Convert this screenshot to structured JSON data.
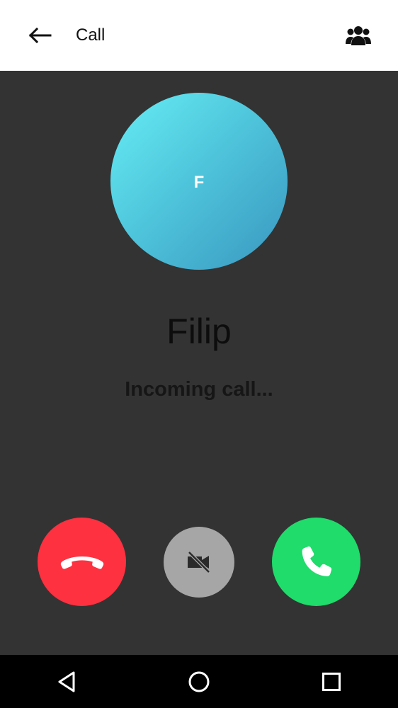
{
  "app_bar": {
    "title": "Call",
    "back_icon": "arrow-left-icon",
    "group_icon": "people-group-icon"
  },
  "caller": {
    "initial": "F",
    "name": "Filip",
    "status": "Incoming call..."
  },
  "actions": {
    "decline_icon": "phone-hangup-icon",
    "video_icon": "video-off-icon",
    "accept_icon": "phone-icon"
  },
  "nav_bar": {
    "back_icon": "nav-back-triangle-icon",
    "home_icon": "nav-home-circle-icon",
    "recents_icon": "nav-recents-square-icon"
  },
  "colors": {
    "background": "#333333",
    "app_bar": "#ffffff",
    "decline": "#fe3140",
    "video": "#a6a6a6",
    "accept": "#1fdc6b",
    "avatar_gradient_start": "#67eef5",
    "avatar_gradient_end": "#3a97c0"
  }
}
